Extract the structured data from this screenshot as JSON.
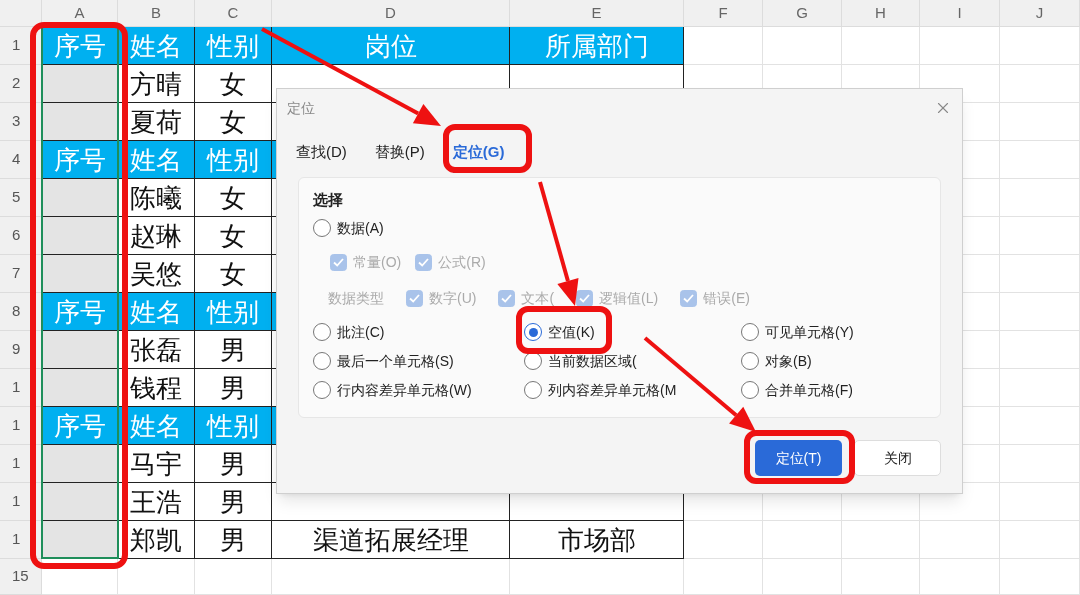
{
  "columns": [
    "A",
    "B",
    "C",
    "D",
    "E",
    "F",
    "G",
    "H",
    "I",
    "J"
  ],
  "rows": [
    {
      "number": "1",
      "kind": "header",
      "cells": [
        "序号",
        "姓名",
        "性别",
        "岗位",
        "所属部门"
      ]
    },
    {
      "number": "2",
      "kind": "data",
      "cells": [
        "方晴",
        "女"
      ]
    },
    {
      "number": "3",
      "kind": "data",
      "cells": [
        "夏荷",
        "女"
      ]
    },
    {
      "number": "4",
      "kind": "header",
      "cells": [
        "序号",
        "姓名",
        "性别"
      ]
    },
    {
      "number": "5",
      "kind": "data",
      "cells": [
        "陈曦",
        "女"
      ]
    },
    {
      "number": "6",
      "kind": "data",
      "cells": [
        "赵琳",
        "女"
      ]
    },
    {
      "number": "7",
      "kind": "data",
      "cells": [
        "吴悠",
        "女"
      ]
    },
    {
      "number": "8",
      "kind": "header",
      "cells": [
        "序号",
        "姓名",
        "性别"
      ]
    },
    {
      "number": "9",
      "kind": "data",
      "cells": [
        "张磊",
        "男"
      ]
    },
    {
      "number": "1",
      "kind": "data",
      "cells": [
        "钱程",
        "男"
      ]
    },
    {
      "number": "1",
      "kind": "header",
      "cells": [
        "序号",
        "姓名",
        "性别"
      ]
    },
    {
      "number": "1",
      "kind": "data",
      "cells": [
        "马宇",
        "男"
      ]
    },
    {
      "number": "1",
      "kind": "data",
      "cells": [
        "王浩",
        "男"
      ]
    },
    {
      "number": "1",
      "kind": "data",
      "cells": [
        "郑凯",
        "男",
        "渠道拓展经理",
        "市场部"
      ]
    },
    {
      "number": "15",
      "kind": "empty",
      "cells": []
    }
  ],
  "dialog": {
    "title": "定位",
    "tabs": [
      {
        "label": "查找(D)",
        "selected": false
      },
      {
        "label": "替换(P)",
        "selected": false
      },
      {
        "label": "定位(G)",
        "selected": true
      }
    ],
    "section_title": "选择",
    "data_option": {
      "label": "数据(A)",
      "selected": false
    },
    "sub_options": [
      {
        "label": "常量(O)",
        "checked": true,
        "disabled": true
      },
      {
        "label": "公式(R)",
        "checked": true,
        "disabled": true
      }
    ],
    "type_label": "数据类型",
    "type_options": [
      {
        "label": "数字(U)",
        "checked": true,
        "disabled": true
      },
      {
        "label": "文本(",
        "checked": true,
        "disabled": true
      },
      {
        "label": "逻辑值(L)",
        "checked": true,
        "disabled": true
      },
      {
        "label": "错误(E)",
        "checked": true,
        "disabled": true
      }
    ],
    "options": [
      {
        "label": "批注(C)",
        "selected": false
      },
      {
        "label": "空值(K)",
        "selected": true
      },
      {
        "label": "可见单元格(Y)",
        "selected": false
      },
      {
        "label": "最后一个单元格(S)",
        "selected": false
      },
      {
        "label": "当前数据区域(",
        "selected": false
      },
      {
        "label": "对象(B)",
        "selected": false
      },
      {
        "label": "行内容差异单元格(W)",
        "selected": false
      },
      {
        "label": "列内容差异单元格(M",
        "selected": false
      },
      {
        "label": "合并单元格(F)",
        "selected": false
      }
    ],
    "buttons": [
      {
        "label": "定位(T)",
        "kind": "primary"
      },
      {
        "label": "关闭",
        "kind": "secondary"
      }
    ]
  }
}
